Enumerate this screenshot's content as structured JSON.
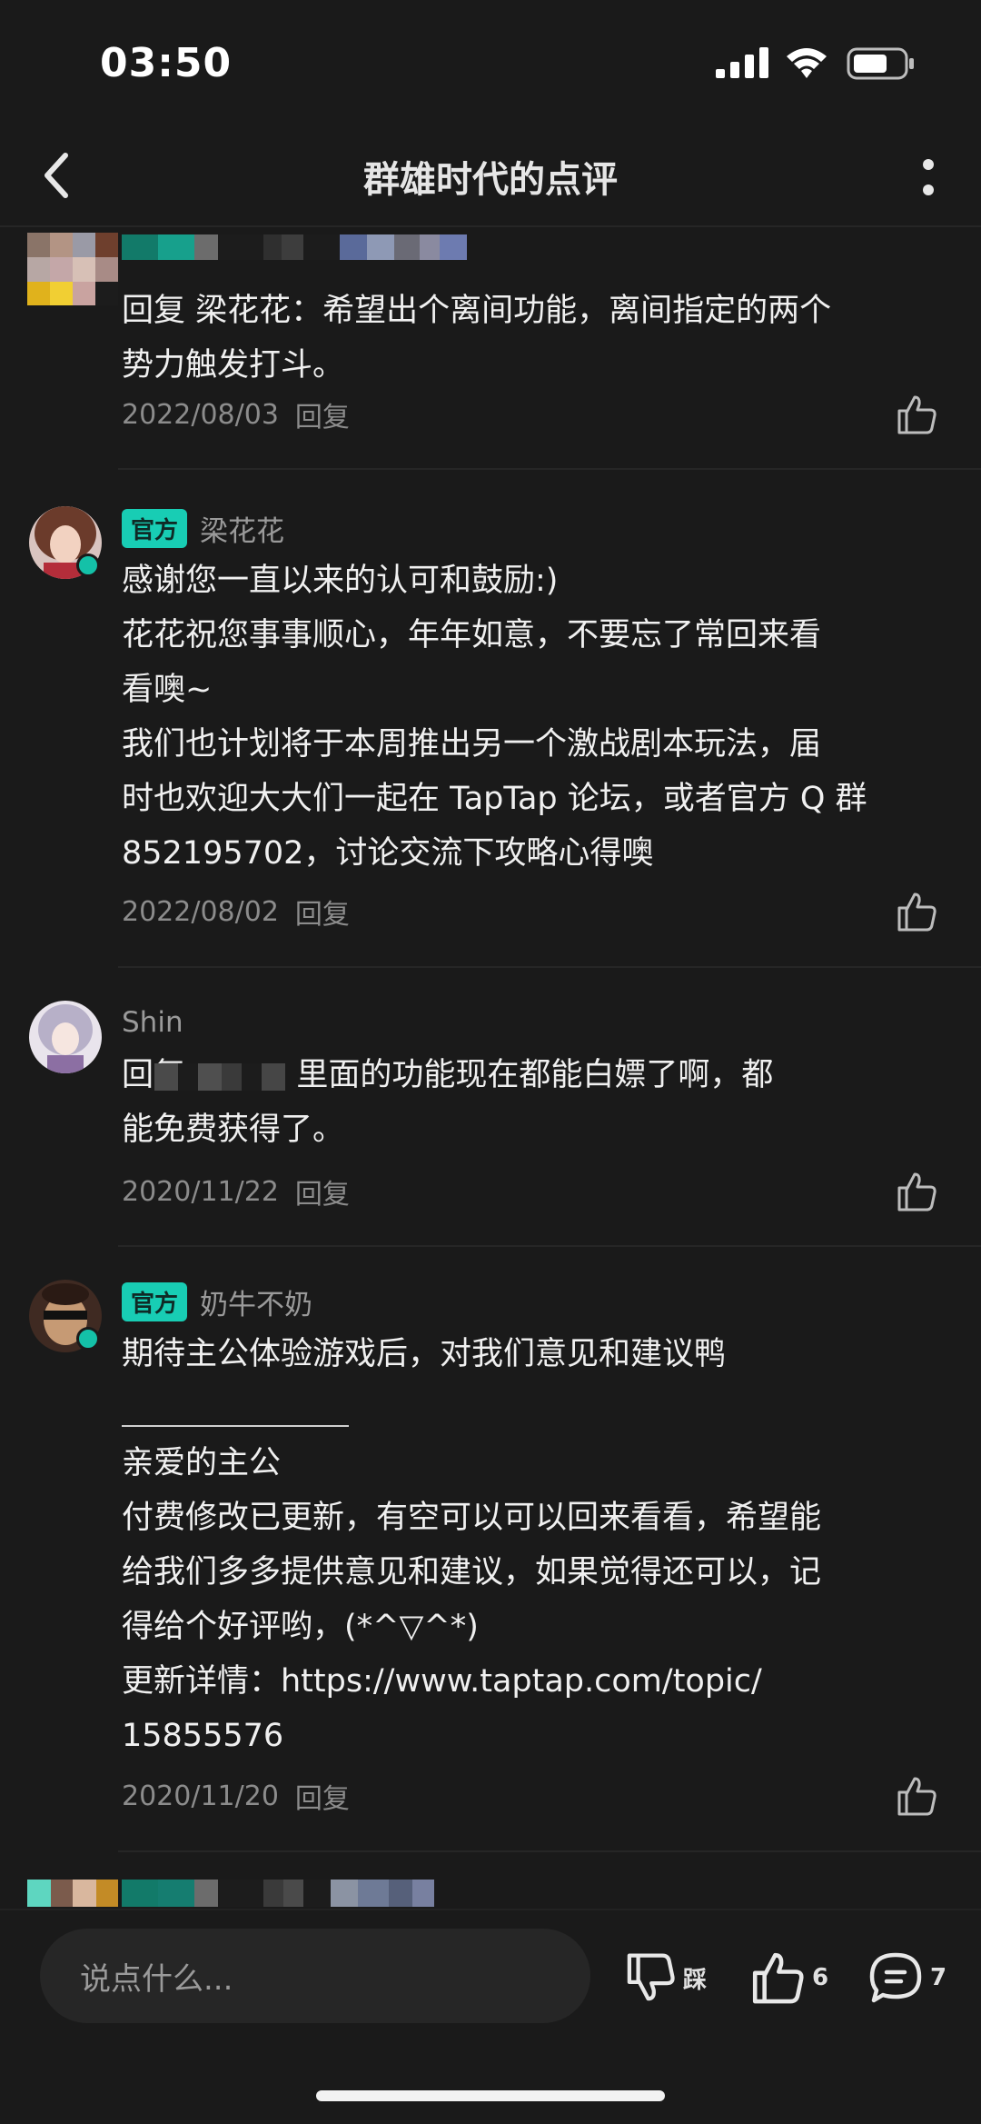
{
  "status": {
    "time": "03:50"
  },
  "header": {
    "title": "群雄时代的点评"
  },
  "comments": [
    {
      "text": "回复 梁花花：希望出个离间功能，离间指定的两个\n势力触发打斗。",
      "date": "2022/08/03",
      "reply": "回复"
    },
    {
      "badge": "官方",
      "author": "梁花花",
      "text": "感谢您一直以来的认可和鼓励:)\n花花祝您事事顺心，年年如意，不要忘了常回来看\n看噢~\n我们也计划将于本周推出另一个激战剧本玩法，届\n时也欢迎大大们一起在 TapTap 论坛，或者官方 Q 群\n852195702，讨论交流下攻略心得噢",
      "date": "2022/08/02",
      "reply": "回复"
    },
    {
      "author": "Shin",
      "text": "回复           里面的功能现在都能白嫖了啊，都\n能免费获得了。",
      "date": "2020/11/22",
      "reply": "回复"
    },
    {
      "badge": "官方",
      "author": "奶牛不奶",
      "text": "期待主公体验游戏后，对我们意见和建议鸭\n\n亲爱的主公\n付费修改已更新，有空可以可以回来看看，希望能\n给我们多多提供意见和建议，如果觉得还可以，记\n得给个好评哟，(*^▽^*)\n更新详情：https://www.taptap.com/topic/\n15855576",
      "separator": "______________",
      "date": "2020/11/20",
      "reply": "回复"
    }
  ],
  "bottom": {
    "placeholder": "说点什么...",
    "dislike_label": "踩",
    "like_count": "6",
    "comment_count": "7"
  },
  "colors": {
    "accent": "#18cdb4",
    "background": "#1a1a1a"
  }
}
